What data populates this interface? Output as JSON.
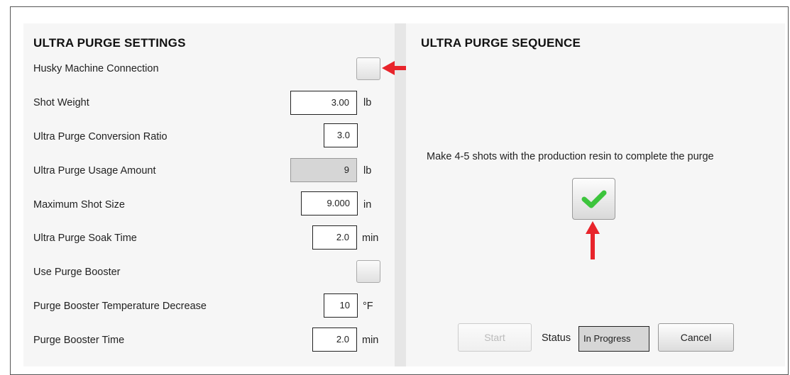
{
  "settings": {
    "title": "ULTRA PURGE SETTINGS",
    "rows": [
      {
        "label": "Husky Machine Connection"
      },
      {
        "label": "Shot Weight",
        "value": "3.00",
        "unit": "lb"
      },
      {
        "label": "Ultra Purge Conversion Ratio",
        "value": "3.0"
      },
      {
        "label": "Ultra Purge Usage Amount",
        "value": "9",
        "unit": "lb"
      },
      {
        "label": "Maximum Shot Size",
        "value": "9.000",
        "unit": "in"
      },
      {
        "label": "Ultra Purge Soak Time",
        "value": "2.0",
        "unit": "min"
      },
      {
        "label": "Use Purge Booster"
      },
      {
        "label": "Purge Booster Temperature Decrease",
        "value": "10",
        "unit": "°F"
      },
      {
        "label": "Purge Booster Time",
        "value": "2.0",
        "unit": "min"
      }
    ]
  },
  "sequence": {
    "title": "ULTRA PURGE SEQUENCE",
    "message": "Make 4-5 shots with the production resin to complete the purge",
    "start_label": "Start",
    "status_label": "Status",
    "status_value": "In Progress",
    "cancel_label": "Cancel"
  },
  "colors": {
    "annotation_arrow": "#e8242b",
    "check_mark": "#3cc43c"
  },
  "icons": {
    "confirm": "check-icon",
    "annotation": "red-arrow-icon"
  }
}
